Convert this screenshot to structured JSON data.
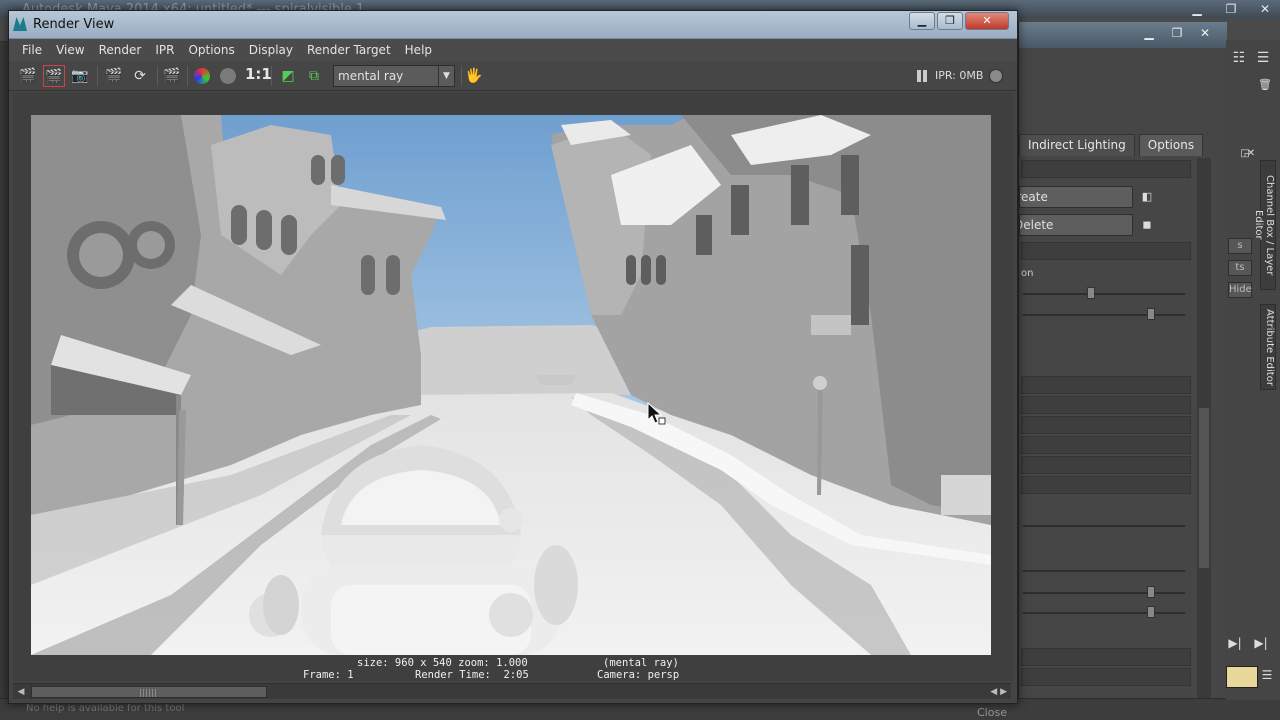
{
  "background_app": {
    "title": "Autodesk Maya 2014 x64: untitled* --- spiralvisible.1",
    "help_line": "No help is available for this tool",
    "close_label": "Close"
  },
  "attribute_editor": {
    "tabs": [
      "Indirect Lighting",
      "Options"
    ],
    "buttons": [
      "Create",
      "Delete"
    ],
    "label_partial": "on",
    "side_buttons": [
      "s",
      "ts",
      "Hide"
    ]
  },
  "side_tabs": {
    "channel_box": "Channel Box / Layer Editor",
    "attribute_editor": "Attribute Editor"
  },
  "render_view": {
    "title": "Render View",
    "menus": [
      "File",
      "View",
      "Render",
      "IPR",
      "Options",
      "Display",
      "Render Target",
      "Help"
    ],
    "toolbar": {
      "ratio_label": "1:1",
      "renderer": "mental ray",
      "ipr_label": "IPR: 0MB"
    },
    "info": {
      "size": "size: 960 x 540 zoom: 1.000",
      "renderer": "(mental ray)",
      "frame": "Frame: 1",
      "render_time": "Render Time:  2:05",
      "camera": "Camera: persp"
    }
  },
  "colors": {
    "titlebar": "#a9bccd",
    "close_button": "#c0392b",
    "sky": "#8fb8de",
    "render_grey": "#d8d8d8"
  }
}
